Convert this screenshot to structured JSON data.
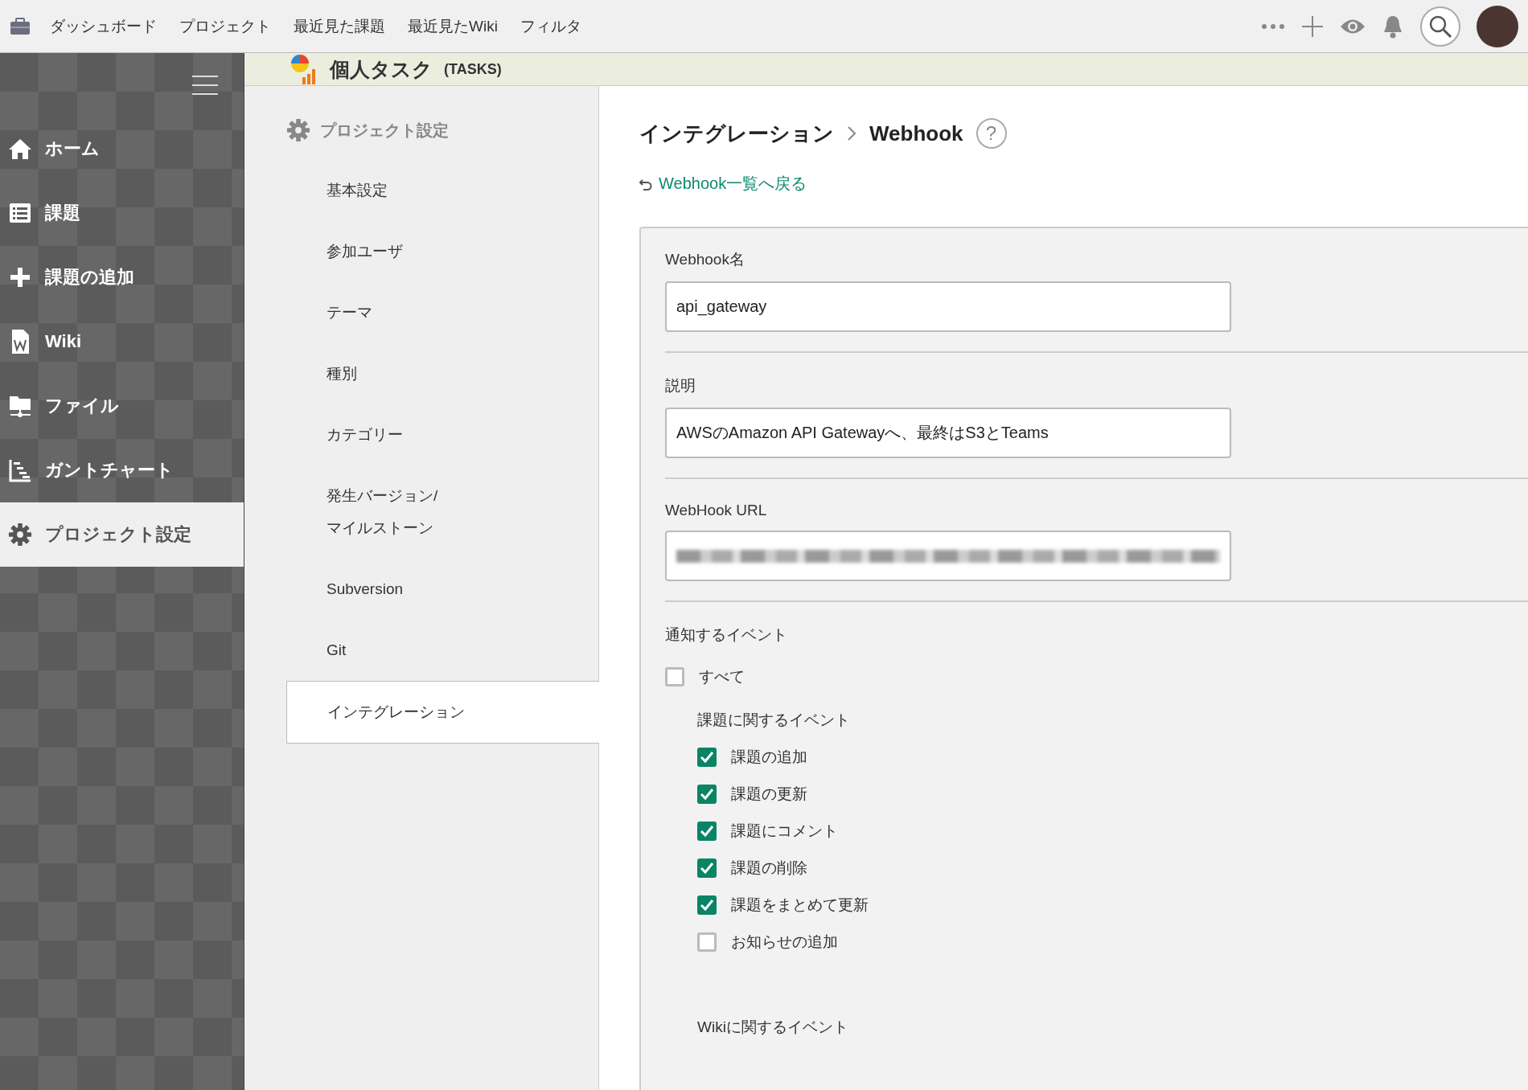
{
  "top_nav": {
    "items": [
      "ダッシュボード",
      "プロジェクト",
      "最近見た課題",
      "最近見たWiki",
      "フィルタ"
    ]
  },
  "left_nav": {
    "items": [
      {
        "label": "ホーム",
        "kind": "home",
        "selected": false
      },
      {
        "label": "課題",
        "kind": "list",
        "selected": false
      },
      {
        "label": "課題の追加",
        "kind": "plus",
        "selected": false
      },
      {
        "label": "Wiki",
        "kind": "wiki",
        "selected": false
      },
      {
        "label": "ファイル",
        "kind": "file",
        "selected": false
      },
      {
        "label": "ガントチャート",
        "kind": "gantt",
        "selected": false
      },
      {
        "label": "プロジェクト設定",
        "kind": "gear",
        "selected": true
      }
    ]
  },
  "project": {
    "name": "個人タスク",
    "key": "(TASKS)"
  },
  "settings_menu": {
    "title": "プロジェクト設定",
    "items": [
      {
        "label": "基本設定",
        "selected": false
      },
      {
        "label": "参加ユーザ",
        "selected": false
      },
      {
        "label": "テーマ",
        "selected": false
      },
      {
        "label": "種別",
        "selected": false
      },
      {
        "label": "カテゴリー",
        "selected": false
      },
      {
        "label": "発生バージョン/\nマイルストーン",
        "selected": false
      },
      {
        "label": "Subversion",
        "selected": false
      },
      {
        "label": "Git",
        "selected": false
      },
      {
        "label": "インテグレーション",
        "selected": true
      }
    ]
  },
  "breadcrumb": {
    "parent": "インテグレーション",
    "current": "Webhook",
    "help": "?"
  },
  "back_link": "Webhook一覧へ戻る",
  "form": {
    "fields": [
      {
        "label": "Webhook名",
        "kind": "text",
        "value": "api_gateway"
      },
      {
        "label": "説明",
        "kind": "text",
        "value": "AWSのAmazon API Gatewayへ、最終はS3とTeams"
      },
      {
        "label": "WebHook URL",
        "kind": "blurred"
      }
    ],
    "events": {
      "label": "通知するイベント",
      "all": {
        "label": "すべて",
        "checked": false
      },
      "groups": [
        {
          "title": "課題に関するイベント",
          "items": [
            {
              "label": "課題の追加",
              "checked": true
            },
            {
              "label": "課題の更新",
              "checked": true
            },
            {
              "label": "課題にコメント",
              "checked": true
            },
            {
              "label": "課題の削除",
              "checked": true
            },
            {
              "label": "課題をまとめて更新",
              "checked": true
            },
            {
              "label": "お知らせの追加",
              "checked": false
            }
          ]
        },
        {
          "title": "Wikiに関するイベント"
        }
      ]
    }
  }
}
